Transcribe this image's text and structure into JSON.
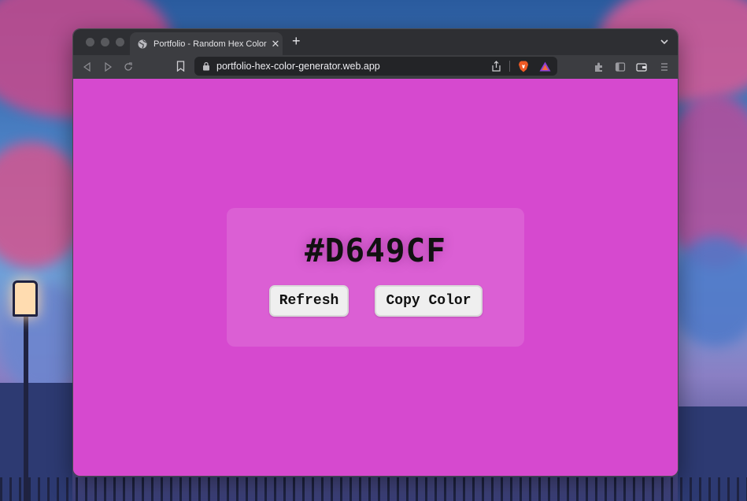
{
  "browser": {
    "tab": {
      "title": "Portfolio - Random Hex Color Generator",
      "favicon": "globe-icon"
    },
    "url": "portfolio-hex-color-generator.web.app",
    "new_tab_label": "+"
  },
  "app": {
    "hex_value": "#D649CF",
    "refresh_label": "Refresh",
    "copy_label": "Copy Color",
    "background_color": "#d649cf"
  },
  "colors": {
    "window_chrome": "#2e2f33",
    "toolbar": "#3c3d41",
    "urlbar": "#232427"
  }
}
